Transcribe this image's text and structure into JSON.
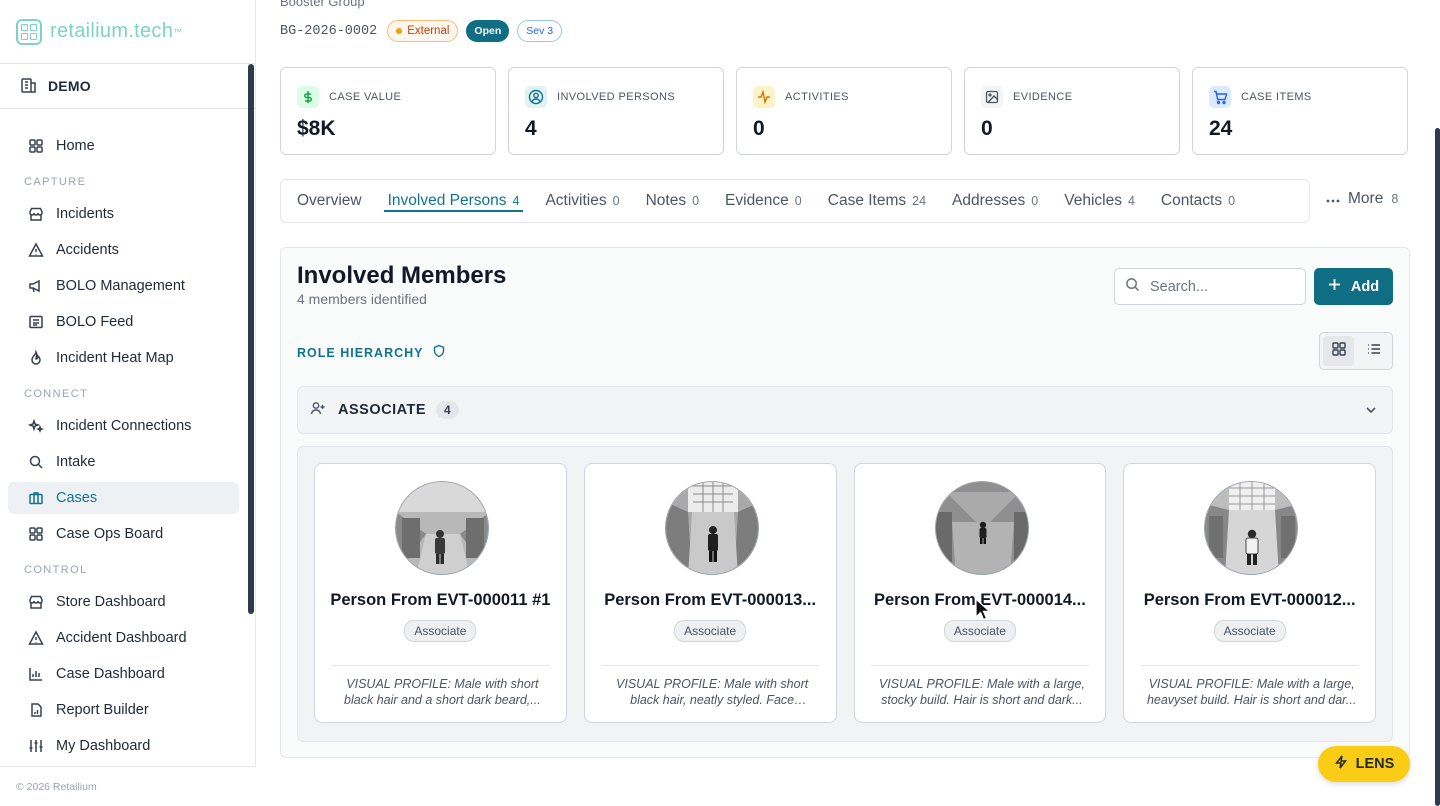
{
  "brand": {
    "name": "retailium.tech",
    "tm": "™"
  },
  "org": {
    "name": "DEMO"
  },
  "nav": {
    "home": "Home",
    "sections": {
      "capture": "CAPTURE",
      "connect": "CONNECT",
      "control": "CONTROL"
    },
    "capture": [
      "Incidents",
      "Accidents",
      "BOLO Management",
      "BOLO Feed",
      "Incident Heat Map"
    ],
    "connect": [
      "Incident Connections",
      "Intake",
      "Cases",
      "Case Ops Board"
    ],
    "control": [
      "Store Dashboard",
      "Accident Dashboard",
      "Case Dashboard",
      "Report Builder",
      "My Dashboard"
    ],
    "active": "Cases"
  },
  "footer": "© 2026 Retailium",
  "case": {
    "group_name": "Booster Group",
    "id": "BG-2026-0002",
    "badges": {
      "type": "External",
      "status": "Open",
      "severity": "Sev 3"
    }
  },
  "stats": [
    {
      "label": "CASE VALUE",
      "value": "$8K",
      "icon": "dollar-icon"
    },
    {
      "label": "INVOLVED PERSONS",
      "value": "4",
      "icon": "user-circle-icon"
    },
    {
      "label": "ACTIVITIES",
      "value": "0",
      "icon": "activity-icon"
    },
    {
      "label": "EVIDENCE",
      "value": "0",
      "icon": "image-icon"
    },
    {
      "label": "CASE ITEMS",
      "value": "24",
      "icon": "cart-icon"
    }
  ],
  "tabs": [
    {
      "label": "Overview",
      "count": ""
    },
    {
      "label": "Involved Persons",
      "count": "4"
    },
    {
      "label": "Activities",
      "count": "0"
    },
    {
      "label": "Notes",
      "count": "0"
    },
    {
      "label": "Evidence",
      "count": "0"
    },
    {
      "label": "Case Items",
      "count": "24"
    },
    {
      "label": "Addresses",
      "count": "0"
    },
    {
      "label": "Vehicles",
      "count": "4"
    },
    {
      "label": "Contacts",
      "count": "0"
    }
  ],
  "more": {
    "label": "More",
    "count": "8"
  },
  "panel": {
    "title": "Involved Members",
    "subtitle": "4 members identified",
    "search_placeholder": "Search...",
    "add_label": "Add",
    "hierarchy_label": "ROLE HIERARCHY",
    "group": {
      "label": "ASSOCIATE",
      "count": "4"
    }
  },
  "members": [
    {
      "name": "Person From EVT-000011 #1",
      "role": "Associate",
      "desc": "VISUAL PROFILE: Male with short black hair and a short dark beard,..."
    },
    {
      "name": "Person From EVT-000013...",
      "role": "Associate",
      "desc": "VISUAL PROFILE: Male with short black hair, neatly styled. Face shows..."
    },
    {
      "name": "Person From EVT-000014...",
      "role": "Associate",
      "desc": "VISUAL PROFILE: Male with a large, stocky build. Hair is short and dark..."
    },
    {
      "name": "Person From EVT-000012...",
      "role": "Associate",
      "desc": "VISUAL PROFILE: Male with a large, heavyset build. Hair is short and dar..."
    }
  ],
  "lens": {
    "label": "LENS"
  },
  "colors": {
    "accent": "#0f6e84",
    "brand": "#7dd3c8",
    "lens": "#facc15"
  }
}
